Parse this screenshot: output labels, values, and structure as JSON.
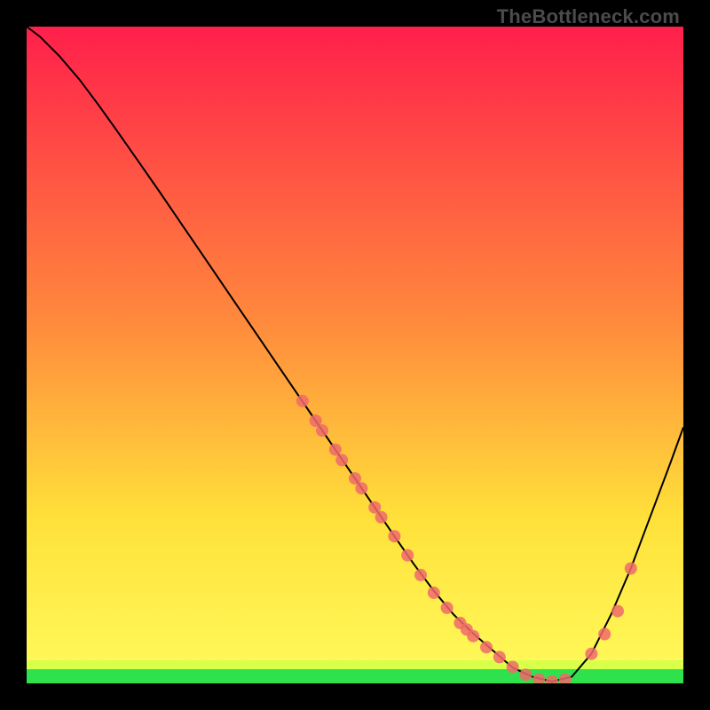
{
  "watermark": "TheBottleneck.com",
  "colors": {
    "gradient_top": "#ff1f4b",
    "gradient_mid1": "#ff6a3c",
    "gradient_mid2": "#ffe13a",
    "gradient_bottom": "#fff95a",
    "green_band": "#2fe24d",
    "curve": "#000000",
    "point": "#f06a6a"
  },
  "chart_data": {
    "type": "line",
    "title": "",
    "xlabel": "",
    "ylabel": "",
    "xlim": [
      0,
      1
    ],
    "ylim": [
      0,
      1
    ],
    "curve": {
      "name": "bottleneck-curve",
      "x": [
        0.0,
        0.02,
        0.05,
        0.08,
        0.11,
        0.14,
        0.17,
        0.2,
        0.23,
        0.26,
        0.29,
        0.32,
        0.35,
        0.38,
        0.41,
        0.44,
        0.47,
        0.5,
        0.53,
        0.56,
        0.59,
        0.62,
        0.65,
        0.68,
        0.71,
        0.74,
        0.77,
        0.8,
        0.83,
        0.86,
        0.89,
        0.92,
        0.95,
        0.98,
        1.0
      ],
      "y": [
        1.0,
        0.985,
        0.955,
        0.92,
        0.88,
        0.838,
        0.795,
        0.752,
        0.708,
        0.664,
        0.62,
        0.576,
        0.532,
        0.488,
        0.444,
        0.4,
        0.356,
        0.312,
        0.268,
        0.224,
        0.181,
        0.141,
        0.105,
        0.076,
        0.05,
        0.024,
        0.01,
        0.003,
        0.01,
        0.045,
        0.105,
        0.175,
        0.255,
        0.335,
        0.39
      ]
    },
    "points": {
      "name": "highlighted-samples",
      "x": [
        0.42,
        0.44,
        0.45,
        0.47,
        0.48,
        0.5,
        0.51,
        0.53,
        0.54,
        0.56,
        0.58,
        0.6,
        0.62,
        0.64,
        0.66,
        0.67,
        0.68,
        0.7,
        0.72,
        0.74,
        0.76,
        0.78,
        0.8,
        0.82,
        0.86,
        0.88,
        0.9,
        0.92
      ],
      "y": [
        0.43,
        0.4,
        0.385,
        0.356,
        0.34,
        0.312,
        0.297,
        0.268,
        0.253,
        0.224,
        0.195,
        0.165,
        0.138,
        0.115,
        0.092,
        0.082,
        0.072,
        0.055,
        0.04,
        0.025,
        0.013,
        0.006,
        0.003,
        0.006,
        0.045,
        0.075,
        0.11,
        0.175
      ]
    }
  }
}
